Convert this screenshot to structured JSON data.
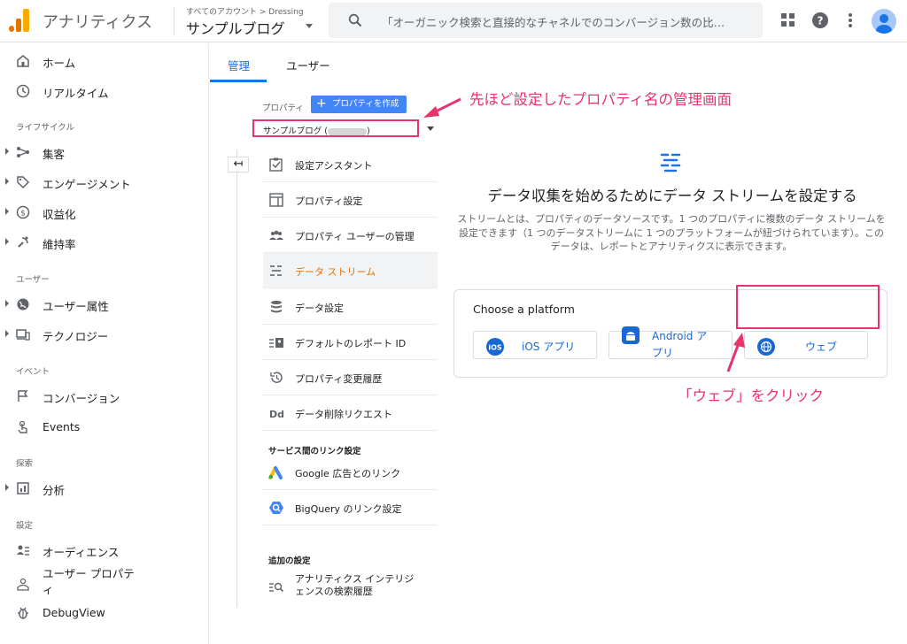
{
  "header": {
    "app_title": "アナリティクス",
    "account_crumb": "すべてのアカウント > Dressing",
    "account_name": "サンプルブログ",
    "search_placeholder": "「オーガニック検索と直接的なチャネルでのコンバージョン数の比…",
    "icons": [
      "apps-grid-icon",
      "help-icon",
      "more-vert-icon",
      "account-avatar"
    ]
  },
  "sidebar": {
    "items_top": [
      {
        "label": "ホーム",
        "icon": "home-icon"
      },
      {
        "label": "リアルタイム",
        "icon": "clock-icon"
      }
    ],
    "section_lifecycle": "ライフサイクル",
    "items_lifecycle": [
      {
        "label": "集客",
        "icon": "acquisition-icon"
      },
      {
        "label": "エンゲージメント",
        "icon": "tag-icon"
      },
      {
        "label": "収益化",
        "icon": "dollar-icon"
      },
      {
        "label": "維持率",
        "icon": "retention-icon"
      }
    ],
    "section_user": "ユーザー",
    "items_user": [
      {
        "label": "ユーザー属性",
        "icon": "globe-icon"
      },
      {
        "label": "テクノロジー",
        "icon": "devices-icon"
      }
    ],
    "section_event": "イベント",
    "items_event": [
      {
        "label": "コンバージョン",
        "icon": "flag-icon"
      },
      {
        "label": "Events",
        "icon": "touch-icon"
      }
    ],
    "section_explore": "探索",
    "items_explore": [
      {
        "label": "分析",
        "icon": "analysis-icon"
      }
    ],
    "section_config": "設定",
    "items_config": [
      {
        "label": "オーディエンス",
        "icon": "audience-icon"
      },
      {
        "label": "ユーザー プロパティ",
        "icon": "user-property-icon"
      },
      {
        "label": "DebugView",
        "icon": "debug-icon"
      }
    ]
  },
  "tabs": [
    {
      "label": "管理",
      "active": true
    },
    {
      "label": "ユーザー",
      "active": false
    }
  ],
  "admin": {
    "property_label": "プロパティ",
    "create_property_button": "プロパティを作成",
    "selected_property": "サンプルブログ (",
    "selected_property_end": ")",
    "menu": [
      {
        "label": "設定アシスタント",
        "icon": "checklist-icon"
      },
      {
        "label": "プロパティ設定",
        "icon": "layout-icon"
      },
      {
        "label": "プロパティ ユーザーの管理",
        "icon": "people-icon"
      },
      {
        "label": "データ ストリーム",
        "icon": "stream-icon",
        "active": true
      },
      {
        "label": "データ設定",
        "icon": "database-icon"
      },
      {
        "label": "デフォルトのレポート ID",
        "icon": "report-id-icon"
      },
      {
        "label": "プロパティ変更履歴",
        "icon": "history-icon"
      },
      {
        "label": "データ削除リクエスト",
        "icon": "dd-icon"
      }
    ],
    "section_links": "サービス間のリンク設定",
    "links": [
      {
        "label": "Google 広告とのリンク",
        "icon": "google-ads-icon"
      },
      {
        "label": "BigQuery のリンク設定",
        "icon": "bigquery-icon"
      }
    ],
    "section_additional": "追加の設定",
    "additional": [
      {
        "label_line1": "アナリティクス インテリジ",
        "label_line2": "ェンスの検索履歴",
        "icon": "search-history-icon"
      }
    ]
  },
  "stream": {
    "title": "データ収集を始めるためにデータ ストリームを設定する",
    "description": "ストリームとは、プロパティのデータソースです。1 つのプロパティに複数のデータ ストリームを設定できます（1 つのデータストリームに 1 つのプラットフォームが紐づけられています）。このデータは、レポートとアナリティクスに表示できます。",
    "choose_platform": "Choose a platform",
    "platforms": [
      {
        "label": "iOS アプリ",
        "icon": "ios-icon"
      },
      {
        "label_line1": "Android ア",
        "label_line2": "プリ",
        "icon": "android-icon"
      },
      {
        "label": "ウェブ",
        "icon": "web-globe-icon"
      }
    ]
  },
  "annotations": {
    "top": "先ほど設定したプロパティ名の管理画面",
    "bottom": "「ウェブ」をクリック",
    "color": "#e8336b"
  },
  "colors": {
    "accent": "#1a73e8",
    "active_menu": "#e8710a",
    "platform_blue": "#1967d2"
  }
}
